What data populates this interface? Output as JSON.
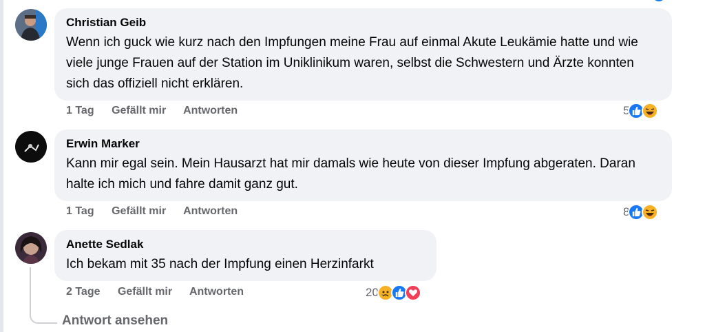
{
  "comments": [
    {
      "author": "Christian Geib",
      "text": "Wenn ich guck wie kurz nach den Impfungen meine Frau auf einmal Akute Leukämie hatte und wie viele junge Frauen auf der Station im Uniklinikum waren, selbst die Schwestern und Ärzte konnten sich das offiziell nicht erklären.",
      "time": "1 Tag",
      "like_label": "Gefällt mir",
      "reply_label": "Antworten",
      "reaction_count": "5",
      "reactions": [
        "like-icon",
        "haha-icon"
      ]
    },
    {
      "author": "Erwin Marker",
      "text": "Kann mir egal sein. Mein Hausarzt hat mir damals wie heute von dieser Impfung abgeraten. Daran halte ich mich und fahre damit ganz gut.",
      "time": "1 Tag",
      "like_label": "Gefällt mir",
      "reply_label": "Antworten",
      "reaction_count": "8",
      "reactions": [
        "like-icon",
        "haha-icon"
      ]
    },
    {
      "author": "Anette Sedlak",
      "text": "Ich bekam mit 35 nach der Impfung einen Herzinfarkt",
      "time": "2 Tage",
      "like_label": "Gefällt mir",
      "reply_label": "Antworten",
      "reaction_count": "20",
      "reactions": [
        "sad-icon",
        "like-icon",
        "love-icon"
      ]
    }
  ],
  "view_replies_label": "Antwort ansehen",
  "colors": {
    "bubble": "#f0f2f5",
    "meta_text": "#65676b",
    "like_blue": "#1877f2",
    "haha_yellow": "#f7b125",
    "love_red": "#f33e58"
  }
}
